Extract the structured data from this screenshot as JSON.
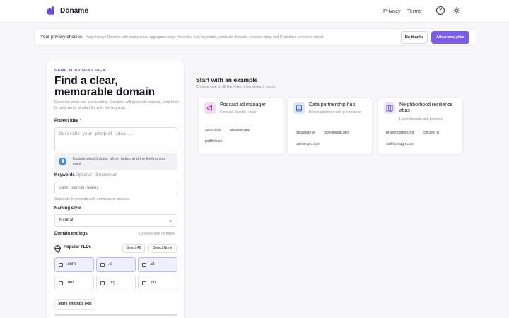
{
  "header": {
    "brand": "Doname",
    "nav": [
      "Privacy",
      "Terms"
    ],
    "icons": [
      "help-circle-icon",
      "sun-icon"
    ]
  },
  "banner": {
    "title": "Your privacy choices",
    "text": "Help improve Doname with anonymous, aggregate usage. Your idea text, keywords, candidate domains, browser string and IP address are never stored.",
    "decline": "No thanks",
    "accept": "Allow analytics"
  },
  "form": {
    "eyebrow": "NAME YOUR NEXT IDEA",
    "headline_line1": "Find a clear,",
    "headline_line2": "memorable domain",
    "subtitle": "Describe what you are building. Doname will generate names, rank their fit, and verify availability with the registrar.",
    "idea_label": "Project idea *",
    "idea_placeholder": "Describe your project idea...",
    "tip": "Include what it does, who it helps, and the feeling you want",
    "keywords_label": "Keywords",
    "keywords_note": "Optional · 3 maximum",
    "keywords_placeholder": "calm, planner, teams",
    "keywords_helper": "Separate keywords with commas or spaces.",
    "style_label": "Naming style",
    "style_value": "Neutral",
    "endings_label": "Domain endings",
    "endings_note": "Choose one or more",
    "popular_label": "Popular TLDs",
    "select_all": "Select All",
    "select_none": "Select None",
    "tlds": [
      {
        "label": ".com",
        "selected": true
      },
      {
        "label": ".io",
        "selected": true
      },
      {
        "label": ".ai",
        "selected": true
      },
      {
        "label": ".net",
        "selected": false
      },
      {
        "label": ".org",
        "selected": false
      },
      {
        "label": ".co",
        "selected": false
      }
    ],
    "more_endings": "More endings (+9)"
  },
  "examples": {
    "title": "Start with an example",
    "subtitle": "Choose one to fill the form, then make it yours.",
    "cards": [
      {
        "name": "Podcast ad manager",
        "desc": "Forecast, bundle, report",
        "domains": [
          "spotmix.io",
          "adcaster.app",
          "podfolio.co"
        ],
        "icon": "megaphone-icon",
        "color": "#f4d9f5"
      },
      {
        "name": "Data partnership hub",
        "desc": "Broker pipelines with governance",
        "domains": [
          "datashare.io",
          "pipelinehub.dev",
          "partnergrid.com"
        ],
        "icon": "database-icon",
        "color": "#dbe6fb"
      },
      {
        "name": "Neighborhood resilience atlas",
        "desc": "Layer hazards and partners",
        "domains": [
          "resiliencemap.org",
          "civicgrid.io",
          "safeborough.com"
        ],
        "icon": "map-icon",
        "color": "#e6e1fb"
      }
    ]
  },
  "colors": {
    "accent": "#7b5ce6",
    "brand": "#6a4ad8",
    "selected_tld_bg": "#eef0fd"
  }
}
